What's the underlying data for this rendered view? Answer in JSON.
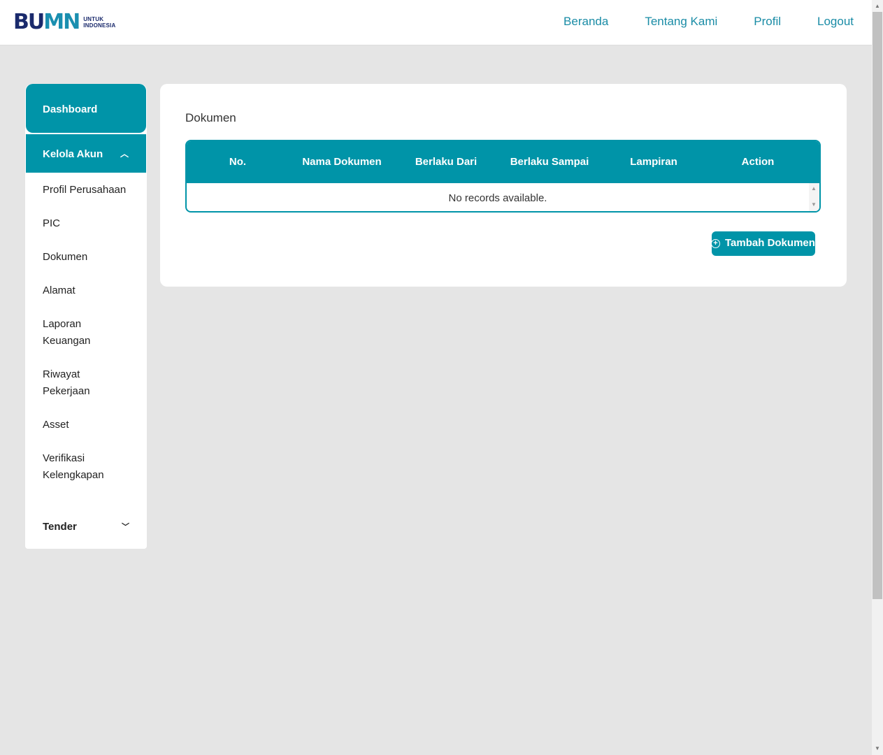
{
  "logo": {
    "main": "BUMN",
    "sub_top": "UNTUK",
    "sub_bottom": "INDONESIA"
  },
  "nav": {
    "items": [
      "Beranda",
      "Tentang Kami",
      "Profil",
      "Logout"
    ]
  },
  "sidebar": {
    "dashboard": "Dashboard",
    "kelola_akun": "Kelola Akun",
    "items": [
      "Profil Perusahaan",
      "PIC",
      "Dokumen",
      "Alamat",
      "Laporan Keuangan",
      "Riwayat Pekerjaan",
      "Asset",
      "Verifikasi Kelengkapan"
    ],
    "tender": "Tender"
  },
  "main": {
    "title": "Dokumen",
    "table": {
      "columns": [
        "No.",
        "Nama Dokumen",
        "Berlaku Dari",
        "Berlaku Sampai",
        "Lampiran",
        "Action"
      ],
      "empty_message": "No records available."
    },
    "add_button": "Tambah Dokumen"
  },
  "colors": {
    "accent": "#0094a8",
    "nav_link": "#1a8ca6",
    "background": "#e5e5e5"
  }
}
